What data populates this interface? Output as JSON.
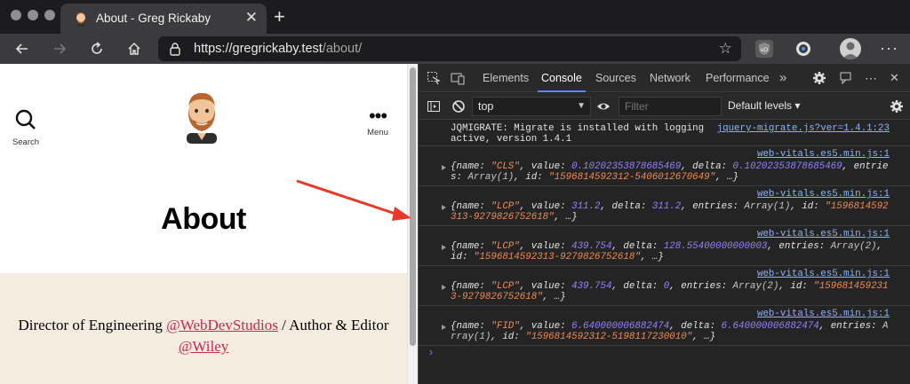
{
  "browser": {
    "tab_title": "About - Greg Rickaby",
    "tab_close": "✕",
    "new_tab": "+",
    "url_host": "https://gregrickaby.test",
    "url_path": "/about/",
    "more": "···",
    "colors": {
      "chrome": "#1c1c1e",
      "toolbar": "#3b3b3d",
      "traffic": "#8e8e93"
    }
  },
  "page": {
    "search_label": "Search",
    "menu_label": "Menu",
    "menu_dots": "•••",
    "title": "About",
    "bio": {
      "part1": "Director of Engineering ",
      "link1": "@WebDevStudios",
      "part2": " / Author & Editor ",
      "link2": "@Wiley"
    },
    "colors": {
      "bio_bg": "#f4ecdf",
      "link": "#cd2653"
    }
  },
  "devtools": {
    "tabs": [
      "Elements",
      "Console",
      "Sources",
      "Network",
      "Performance"
    ],
    "tabs_more": "»",
    "active_tab": "Console",
    "close": "✕",
    "context": "top",
    "filter_placeholder": "Filter",
    "levels": "Default levels ▾",
    "messages": [
      {
        "source": "jquery-migrate.js?ver=1.4.1:23",
        "text": "JQMIGRATE: Migrate is installed with logging\nactive, version 1.4.1"
      },
      {
        "source": "web-vitals.es5.min.js:1",
        "name": "\"CLS\"",
        "value": "0.10202353878685469",
        "delta": "0.10202353878685469",
        "entries": "Array(1)",
        "id": "\"1596814592312-5406012670649\""
      },
      {
        "source": "web-vitals.es5.min.js:1",
        "name": "\"LCP\"",
        "value": "311.2",
        "delta": "311.2",
        "entries": "Array(1)",
        "id": "\"1596814592313-9279826752618\""
      },
      {
        "source": "web-vitals.es5.min.js:1",
        "name": "\"LCP\"",
        "value": "439.754",
        "delta": "128.55400000000003",
        "entries": "Array(2)",
        "id": "\"1596814592313-9279826752618\""
      },
      {
        "source": "web-vitals.es5.min.js:1",
        "name": "\"LCP\"",
        "value": "439.754",
        "delta": "0",
        "entries": "Array(2)",
        "id": "\"1596814592313-9279826752618\""
      },
      {
        "source": "web-vitals.es5.min.js:1",
        "name": "\"FID\"",
        "value": "6.640000006882474",
        "delta": "6.640000006882474",
        "entries": "Array(1)",
        "id": "\"1596814592312-5198117230010\""
      }
    ],
    "prompt": "›",
    "colors": {
      "bg": "#242424",
      "string": "#f28b54",
      "number": "#9980ff",
      "link": "#8ab4f8",
      "accent": "#4d8ef7"
    }
  },
  "annotation": {
    "arrow_color": "#e8392a"
  }
}
